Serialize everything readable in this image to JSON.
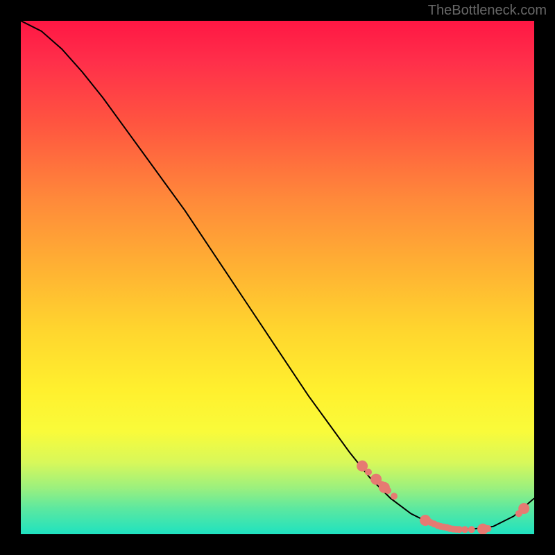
{
  "watermark": "TheBottleneck.com",
  "chart_data": {
    "type": "line",
    "title": "",
    "xlabel": "",
    "ylabel": "",
    "xlim": [
      0,
      100
    ],
    "ylim": [
      0,
      100
    ],
    "grid": false,
    "series": [
      {
        "name": "curve",
        "x": [
          0,
          4,
          8,
          12,
          16,
          20,
          24,
          28,
          32,
          36,
          40,
          44,
          48,
          52,
          56,
          60,
          64,
          68,
          72,
          76,
          80,
          84,
          88,
          92,
          96,
          100
        ],
        "y": [
          100,
          98,
          94.5,
          90,
          85,
          79.5,
          74,
          68.5,
          63,
          57,
          51,
          45,
          39,
          33,
          27,
          21.5,
          16,
          11,
          7,
          4,
          2,
          1,
          1,
          1.5,
          3.5,
          7
        ]
      }
    ],
    "highlight_points": [
      {
        "x": 66.5,
        "y": 13.3,
        "size": "big"
      },
      {
        "x": 67.7,
        "y": 12.1,
        "size": "small"
      },
      {
        "x": 69.2,
        "y": 10.7,
        "size": "big"
      },
      {
        "x": 70.3,
        "y": 9.7,
        "size": "small"
      },
      {
        "x": 70.8,
        "y": 9.1,
        "size": "big"
      },
      {
        "x": 71.5,
        "y": 8.5,
        "size": "small"
      },
      {
        "x": 72.7,
        "y": 7.4,
        "size": "small"
      },
      {
        "x": 78.8,
        "y": 2.7,
        "size": "big"
      },
      {
        "x": 79.8,
        "y": 2.3,
        "size": "small"
      },
      {
        "x": 80.5,
        "y": 2.0,
        "size": "small"
      },
      {
        "x": 81.2,
        "y": 1.7,
        "size": "small"
      },
      {
        "x": 81.8,
        "y": 1.5,
        "size": "small"
      },
      {
        "x": 82.4,
        "y": 1.4,
        "size": "small"
      },
      {
        "x": 83.0,
        "y": 1.3,
        "size": "small"
      },
      {
        "x": 83.6,
        "y": 1.1,
        "size": "small"
      },
      {
        "x": 84.2,
        "y": 1.0,
        "size": "small"
      },
      {
        "x": 84.8,
        "y": 0.95,
        "size": "small"
      },
      {
        "x": 85.4,
        "y": 0.92,
        "size": "small"
      },
      {
        "x": 86.5,
        "y": 0.9,
        "size": "small"
      },
      {
        "x": 87.8,
        "y": 0.9,
        "size": "small"
      },
      {
        "x": 90.0,
        "y": 1.0,
        "size": "big"
      },
      {
        "x": 91.0,
        "y": 1.1,
        "size": "small"
      },
      {
        "x": 97.0,
        "y": 4.0,
        "size": "small"
      },
      {
        "x": 98.0,
        "y": 5.0,
        "size": "big"
      }
    ]
  }
}
